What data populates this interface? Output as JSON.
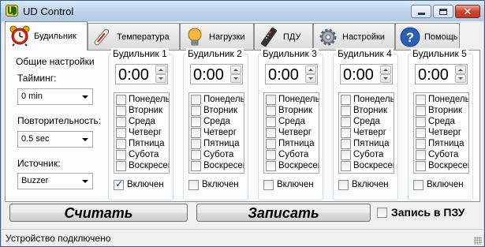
{
  "window": {
    "title": "UD Control"
  },
  "tabs": [
    {
      "label": "Будильник",
      "icon": "alarm-clock-icon",
      "active": true
    },
    {
      "label": "Температура",
      "icon": "thermometer-icon",
      "active": false
    },
    {
      "label": "Нагрузки",
      "icon": "lightbulb-icon",
      "active": false
    },
    {
      "label": "ПДУ",
      "icon": "remote-control-icon",
      "active": false
    },
    {
      "label": "Настройки",
      "icon": "gear-icon",
      "active": false
    },
    {
      "label": "Помощь",
      "icon": "help-icon",
      "active": false
    }
  ],
  "general": {
    "title": "Общие настройки",
    "timing_label": "Тайминг:",
    "timing_value": "0 min",
    "repeat_label": "Повторительность:",
    "repeat_value": "0.5 sec",
    "source_label": "Источник:",
    "source_value": "Buzzer"
  },
  "alarms": [
    {
      "title": "Будильник 1",
      "time": "0:00",
      "enabled": true
    },
    {
      "title": "Будильник 2",
      "time": "0:00",
      "enabled": false
    },
    {
      "title": "Будильник 3",
      "time": "0:00",
      "enabled": false
    },
    {
      "title": "Будильник 4",
      "time": "0:00",
      "enabled": false
    },
    {
      "title": "Будильник 5",
      "time": "0:00",
      "enabled": false
    }
  ],
  "days": [
    "Понедельн",
    "Вторник",
    "Среда",
    "Четверг",
    "Пятница",
    "Субота",
    "Воскресень"
  ],
  "enable_label": "Включен",
  "buttons": {
    "read": "Считать",
    "write": "Записать",
    "rom_label": "Запись в ПЗУ"
  },
  "status": {
    "text": "Устройство подключено"
  },
  "colors": {
    "titlebar": "#bcd3ea",
    "close_button": "#c9452f",
    "panel": "#fcfcfc"
  }
}
